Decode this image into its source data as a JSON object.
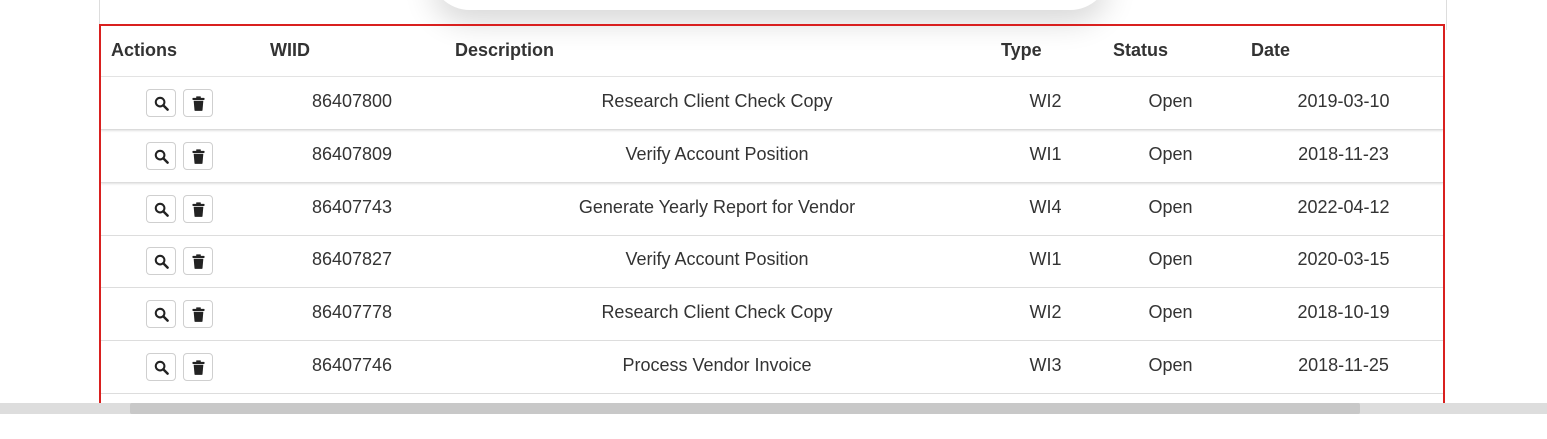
{
  "table": {
    "headers": {
      "actions": "Actions",
      "wiid": "WIID",
      "description": "Description",
      "type": "Type",
      "status": "Status",
      "date": "Date"
    },
    "rows": [
      {
        "wiid": "86407800",
        "description": "Research Client Check Copy",
        "type": "WI2",
        "status": "Open",
        "date": "2019-03-10"
      },
      {
        "wiid": "86407809",
        "description": "Verify Account Position",
        "type": "WI1",
        "status": "Open",
        "date": "2018-11-23"
      },
      {
        "wiid": "86407743",
        "description": "Generate Yearly Report for Vendor",
        "type": "WI4",
        "status": "Open",
        "date": "2022-04-12"
      },
      {
        "wiid": "86407827",
        "description": "Verify Account Position",
        "type": "WI1",
        "status": "Open",
        "date": "2020-03-15"
      },
      {
        "wiid": "86407778",
        "description": "Research Client Check Copy",
        "type": "WI2",
        "status": "Open",
        "date": "2018-10-19"
      },
      {
        "wiid": "86407746",
        "description": "Process Vendor Invoice",
        "type": "WI3",
        "status": "Open",
        "date": "2018-11-25"
      }
    ],
    "row_actions": [
      "search-icon",
      "trash-icon"
    ]
  },
  "colors": {
    "highlight_border": "#d9201f",
    "text": "#333333",
    "row_border": "#dddddd"
  }
}
